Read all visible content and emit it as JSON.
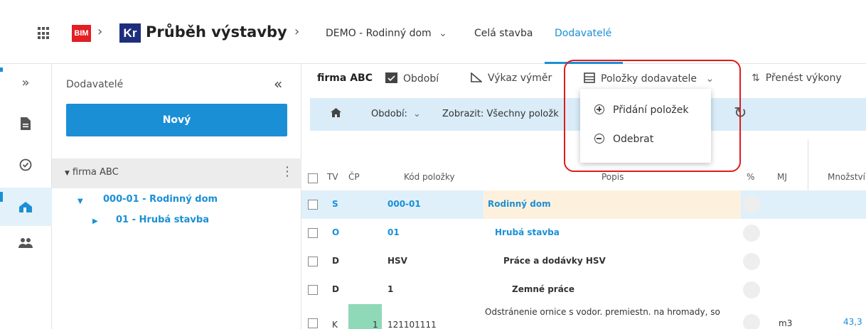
{
  "header": {
    "logo_bim": "BIM",
    "logo_kr": "Kr",
    "app_title": "Průběh výstavby",
    "nav": [
      "DEMO - Rodinný dom",
      "Celá stavba",
      "Dodavatelé"
    ],
    "active_nav": "Dodavatelé",
    "project_chevron": "⌄"
  },
  "sidebar": {
    "title": "Dodavatelé",
    "new_button": "Nový",
    "tree_root": "firma ABC",
    "tree_nodes": [
      "000-01 - Rodinný dom",
      "01 - Hrubá stavba"
    ]
  },
  "toolbar": {
    "firma": "firma ABC",
    "obdobi": "Období",
    "vykaz": "Výkaz výměr",
    "polozky": "Položky dodavatele",
    "prenest": "Přenést výkony"
  },
  "filter": {
    "obdobi_label": "Období:",
    "zobrazit_label": "Zobrazit:",
    "zobrazit_value": "Všechny položk"
  },
  "menu": {
    "items": [
      "Přidání položek",
      "Odebrat"
    ]
  },
  "table": {
    "columns": [
      "TV",
      "ČP",
      "Kód položky",
      "Popis",
      "%",
      "MJ",
      "Množství"
    ],
    "rows": [
      {
        "tv": "S",
        "cp": "",
        "code": "000-01",
        "desc": "Rodinný dom",
        "mj": "",
        "qty": ""
      },
      {
        "tv": "O",
        "cp": "",
        "code": "01",
        "desc": "Hrubá stavba",
        "mj": "",
        "qty": ""
      },
      {
        "tv": "D",
        "cp": "",
        "code": "HSV",
        "desc": "Práce a dodávky HSV",
        "mj": "",
        "qty": ""
      },
      {
        "tv": "D",
        "cp": "",
        "code": "1",
        "desc": "Zemné práce",
        "mj": "",
        "qty": ""
      },
      {
        "tv": "K",
        "cp": "1",
        "code": "121101111",
        "desc": "Odstránenie ornice s vodor. premiestn. na hromady, so",
        "mj": "m3",
        "qty": "43,3"
      }
    ]
  },
  "colors": {
    "accent": "#1a8fd6",
    "filter_bg": "#d9ecf8",
    "highlight": "#e01b1b"
  }
}
